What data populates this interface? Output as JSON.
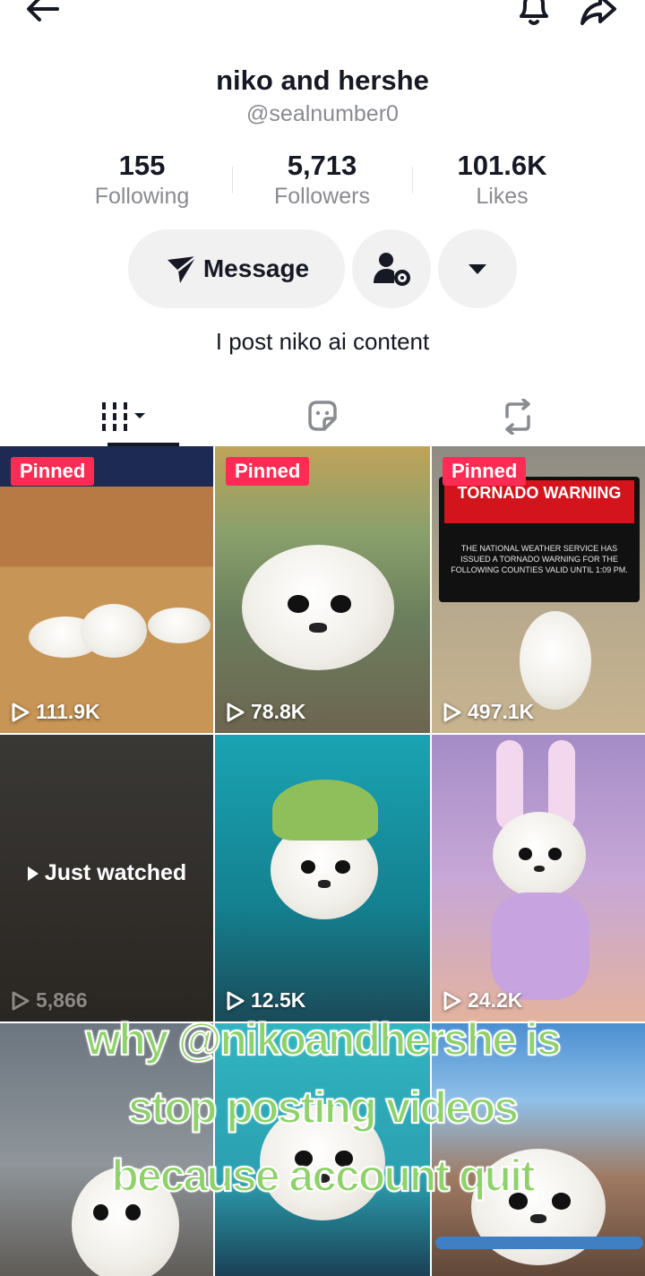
{
  "profile": {
    "name": "niko and hershe",
    "handle": "@sealnumber0",
    "bio": "I post niko ai content"
  },
  "stats": [
    {
      "value": "155",
      "label": "Following"
    },
    {
      "value": "5,713",
      "label": "Followers"
    },
    {
      "value": "101.6K",
      "label": "Likes"
    }
  ],
  "actions": {
    "message_label": "Message"
  },
  "videos": [
    {
      "pinned_label": "Pinned",
      "views": "111.9K"
    },
    {
      "pinned_label": "Pinned",
      "views": "78.8K"
    },
    {
      "pinned_label": "Pinned",
      "views": "497.1K",
      "tv_headline": "TORNADO WARNING",
      "tv_text": "THE NATIONAL WEATHER SERVICE HAS ISSUED A TORNADO WARNING FOR THE FOLLOWING COUNTIES VALID UNTIL 1:09 PM."
    },
    {
      "overlay": "Just watched",
      "views": "5,866"
    },
    {
      "views": "12.5K"
    },
    {
      "views": "24.2K"
    },
    {},
    {},
    {}
  ],
  "caption": {
    "line1": "why @nikoandhershe is",
    "line2": "stop posting videos",
    "line3": "because account quit"
  },
  "colors": {
    "accent_pinned": "#fe2c55",
    "caption_green": "#8fd16a"
  }
}
